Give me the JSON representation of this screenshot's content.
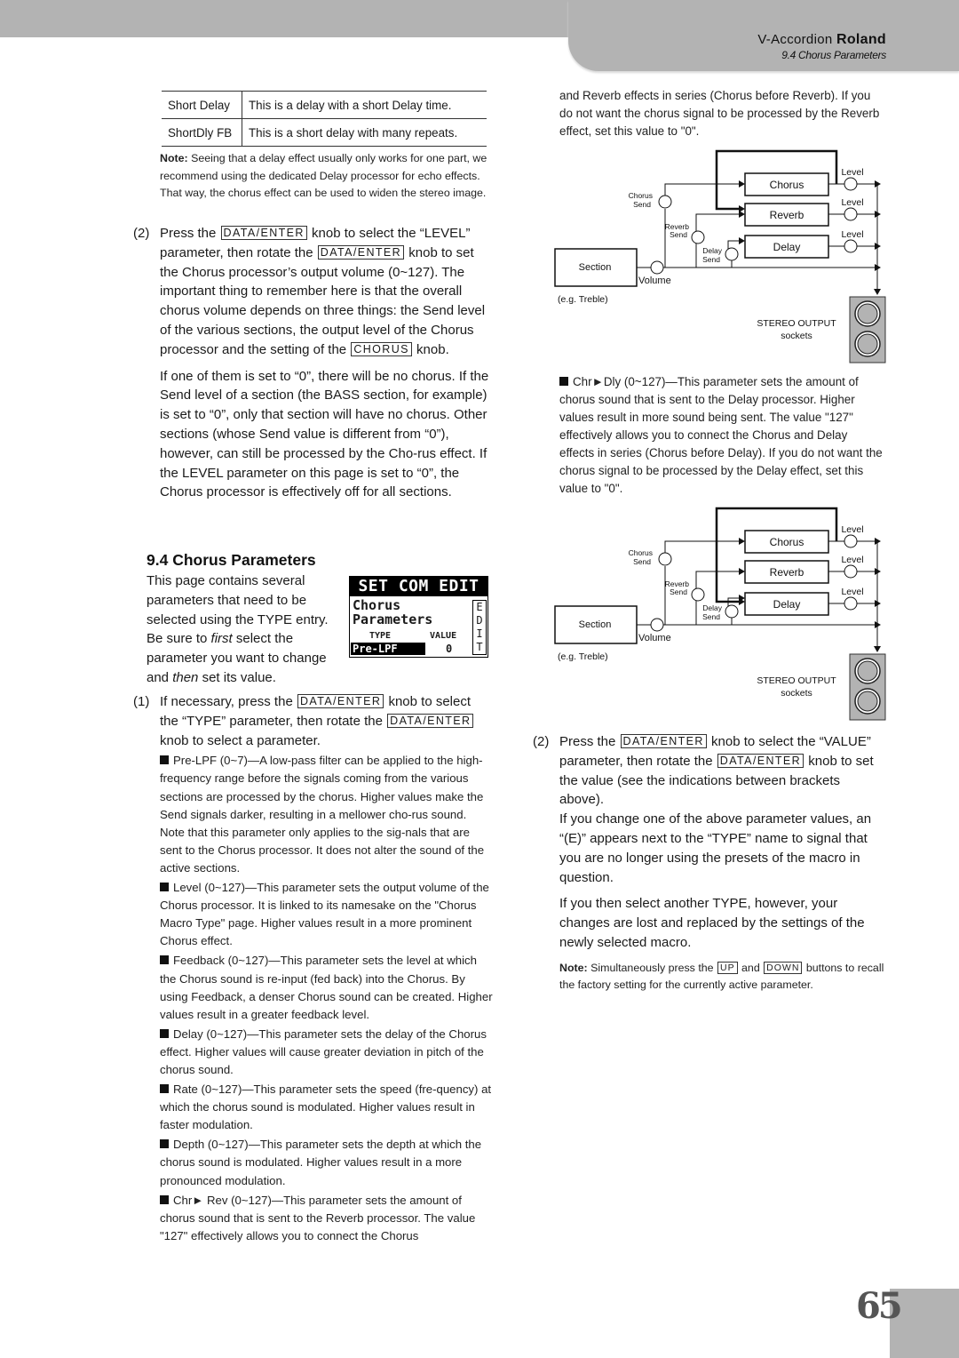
{
  "header": {
    "product": "V-Accordion",
    "brand": "Roland",
    "section": "9.4 Chorus Parameters"
  },
  "type_table": [
    {
      "name": "Short Delay",
      "desc": "This is a delay with a short Delay time."
    },
    {
      "name": "ShortDly FB",
      "desc": "This is a short delay with many repeats."
    }
  ],
  "note1": {
    "label": "Note:",
    "text": " Seeing that a delay effect usually only works for one part, we recommend using the dedicated Delay processor for echo effects. That way, the chorus effect can be used to widen the stereo image."
  },
  "step2_level": {
    "num": "(2)",
    "t1": "Press the ",
    "k1": "DATA/ENTER",
    "t2": " knob to select the “LEVEL” parameter, then rotate the ",
    "k2": "DATA/ENTER",
    "t3": " knob to set the Chorus processor’s output volume (0~127). The important thing to remember here is that the overall chorus volume depends on three things: the Send level of the various sections, the output level of the Chorus processor and the setting of the ",
    "k3": "CHORUS",
    "t4": " knob.",
    "para2": "If one of them is set to “0”, there will be no chorus. If the Send level of a section (the BASS section, for example) is set to “0”, only that section will have no chorus. Other sections (whose Send value is different from “0”), however, can still be processed by the Cho-rus effect. If the LEVEL parameter on this page is set to “0”, the Chorus processor is effectively off for all sections."
  },
  "section_title": "9.4 Chorus Parameters",
  "intro": {
    "t1": "This page contains several parameters that need to be selected using the TYPE entry. Be sure to ",
    "em1": "first",
    "t2": " select the parameter you want to change and ",
    "em2": "then",
    "t3": " set its value."
  },
  "lcd": {
    "header": "SET COM EDIT",
    "line1": "Chorus",
    "line2": "Parameters",
    "type_label": "TYPE",
    "value_label": "VALUE",
    "type_value": "Pre-LPF",
    "value": "0",
    "side": [
      "E",
      "D",
      "I",
      "T"
    ]
  },
  "step1": {
    "num": "(1)",
    "t1": "If necessary, press the ",
    "k1": "DATA/ENTER",
    "t2": " knob to select the “TYPE” parameter, then rotate the ",
    "k2": "DATA/ENTER",
    "t3": " knob to select a parameter."
  },
  "params": [
    {
      "name": "Pre-LPF (0~7)",
      "desc": "—A low-pass filter can be applied to the high-frequency range before the signals coming from the various sections are processed by the chorus. Higher values make the Send signals darker, resulting in a mellower cho-rus sound. Note that this parameter only applies to the sig-nals that are sent to the Chorus processor. It does not alter the sound of the active sections."
    },
    {
      "name": "Level (0~127)",
      "desc": "—This parameter sets the output volume of the Chorus processor. It is linked to its namesake on the \"Chorus Macro Type\" page. Higher values result in a more prominent Chorus effect."
    },
    {
      "name": "Feedback (0~127)",
      "desc": "—This parameter sets the level at which the Chorus sound is re-input (fed back) into the Chorus. By using Feedback, a denser Chorus sound can be created. Higher values result in a greater feedback level."
    },
    {
      "name": "Delay (0~127)",
      "desc": "—This parameter sets the delay of the Chorus effect. Higher values will cause greater deviation in pitch of the chorus sound."
    },
    {
      "name": "Rate (0~127)",
      "desc": "—This parameter sets the speed (fre-quency) at which the chorus sound is modulated. Higher values result in faster modulation."
    },
    {
      "name": "Depth (0~127)",
      "desc": "—This parameter sets the depth at which the chorus sound is modulated. Higher values result in a more pronounced modulation."
    },
    {
      "name": "Chr► Rev (0~127)",
      "desc": "—This parameter sets the amount of chorus sound that is sent to the Reverb processor. The value \"127\" effectively allows you to connect the Chorus"
    }
  ],
  "right_cont": "and Reverb effects in series (Chorus before Reverb). If you do not want the chorus signal to be processed by the Reverb effect, set this value to \"0\".",
  "diagram": {
    "chorus": "Chorus",
    "reverb": "Reverb",
    "delay": "Delay",
    "level": "Level",
    "chorus_send_1": "Chorus",
    "chorus_send_2": "Send",
    "reverb_send_1": "Reverb",
    "reverb_send_2": "Send",
    "delay_send_1": "Delay",
    "delay_send_2": "Send",
    "section": "Section",
    "volume": "Volume",
    "example": "(e.g. Treble)",
    "output_1": "STEREO OUTPUT",
    "output_2": "sockets"
  },
  "param_chrdly": {
    "name": "Chr►Dly (0~127)",
    "desc": "—This parameter sets the amount of chorus sound that is sent to the Delay processor. Higher values result in more sound being sent. The value \"127\" effectively allows you to connect the Chorus and Delay effects in series (Chorus before Delay). If you do not want the chorus signal to be processed by the Delay effect, set this value to \"0\"."
  },
  "step2_value": {
    "num": "(2)",
    "t1": "Press the ",
    "k1": "DATA/ENTER",
    "t2": " knob to select the “VALUE” parameter, then rotate the ",
    "k2": "DATA/ENTER",
    "t3": " knob to set the value (see the indications between brackets above).",
    "para2": "If you change one of the above parameter values, an “(E)” appears next to the “TYPE” name to signal that you are no longer using the presets of the macro in question.",
    "para3": "If you then select another TYPE, however, your changes are lost and replaced by the settings of the newly selected macro."
  },
  "note2": {
    "label": "Note:",
    "t1": " Simultaneously press the ",
    "k1": "UP",
    "t2": " and ",
    "k2": "DOWN",
    "t3": " buttons to recall the factory setting for the currently active parameter."
  },
  "page_number": "65"
}
